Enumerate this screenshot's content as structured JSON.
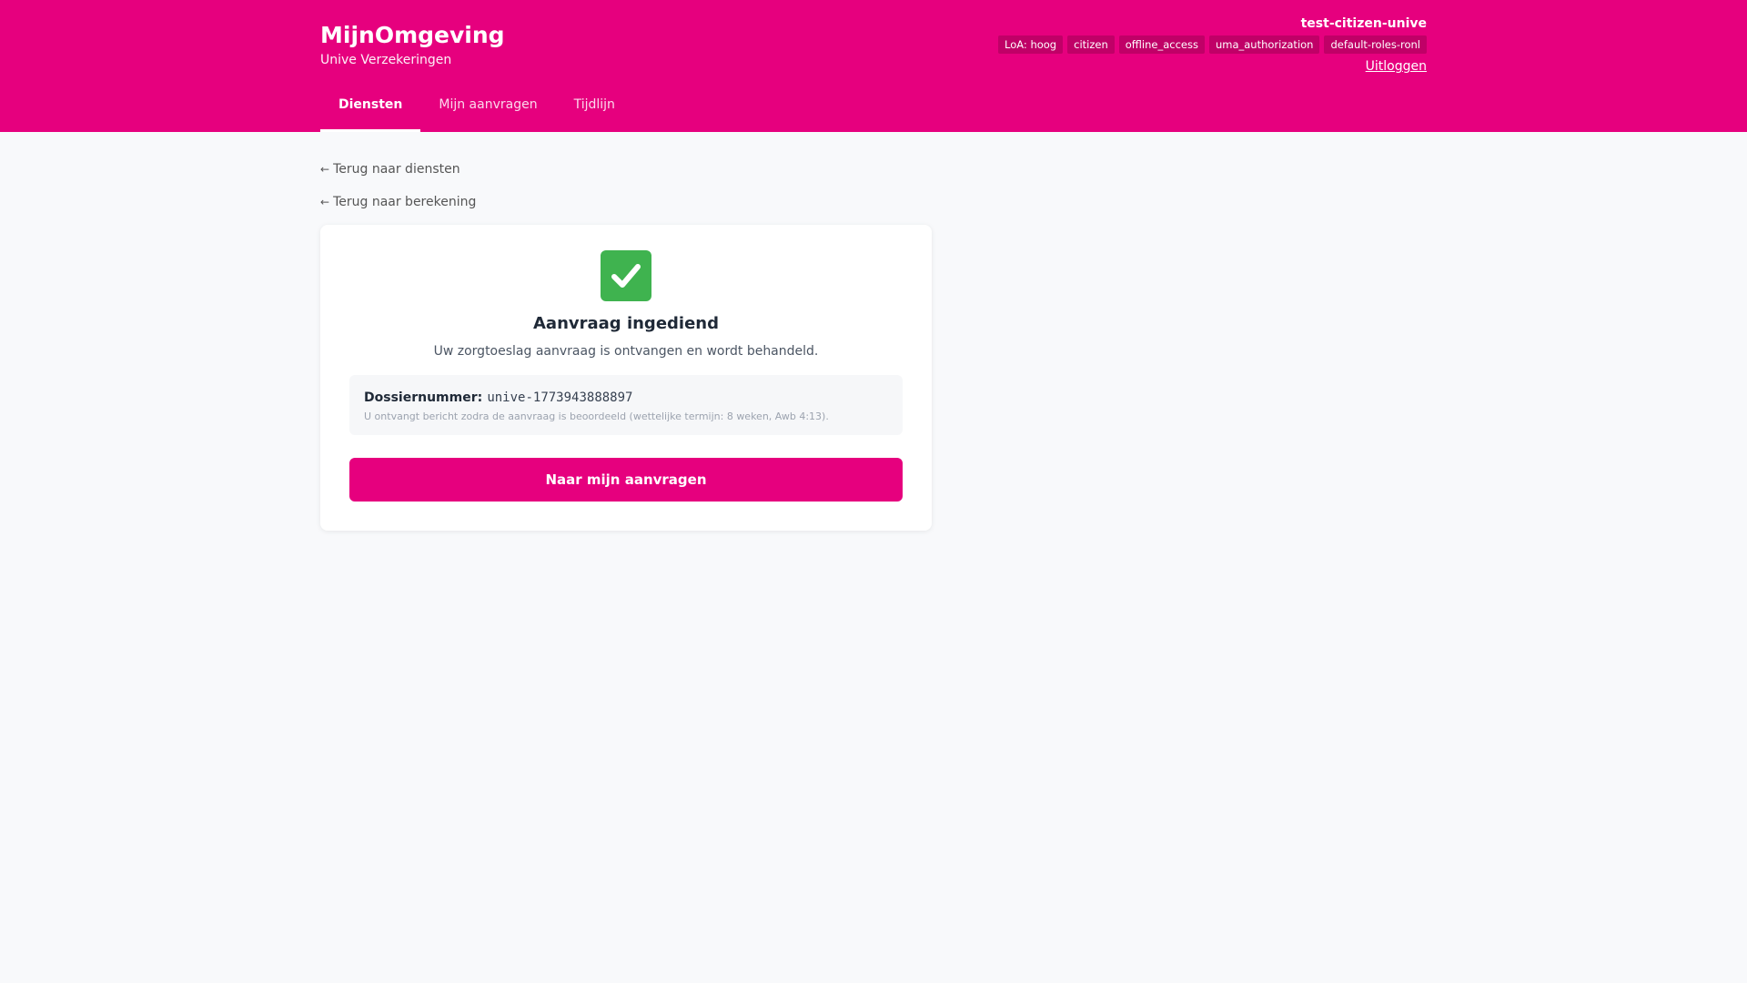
{
  "header": {
    "title": "MijnOmgeving",
    "subtitle": "Unive Verzekeringen",
    "username": "test-citizen-unive",
    "badges": [
      "LoA: hoog",
      "citizen",
      "offline_access",
      "uma_authorization",
      "default-roles-ronl"
    ],
    "logout_label": "Uitloggen"
  },
  "nav": {
    "tabs": [
      {
        "label": "Diensten",
        "active": true
      },
      {
        "label": "Mijn aanvragen",
        "active": false
      },
      {
        "label": "Tijdlijn",
        "active": false
      }
    ]
  },
  "back_links": [
    {
      "arrow": "←",
      "label": "Terug naar diensten"
    },
    {
      "arrow": "←",
      "label": "Terug naar berekening"
    }
  ],
  "card": {
    "icon": "check-mark-icon",
    "title": "Aanvraag ingediend",
    "message": "Uw zorgtoeslag aanvraag is ontvangen en wordt behandeld.",
    "dossier_label": "Dossiernummer:",
    "dossier_value": "unive-1773943888897",
    "dossier_note": "U ontvangt bericht zodra de aanvraag is beoordeeld (wettelijke termijn: 8 weken, Awb 4:13).",
    "button_label": "Naar mijn aanvragen"
  },
  "colors": {
    "brand": "#e6007e",
    "success": "#3fb34f",
    "background": "#f8f9fb"
  }
}
